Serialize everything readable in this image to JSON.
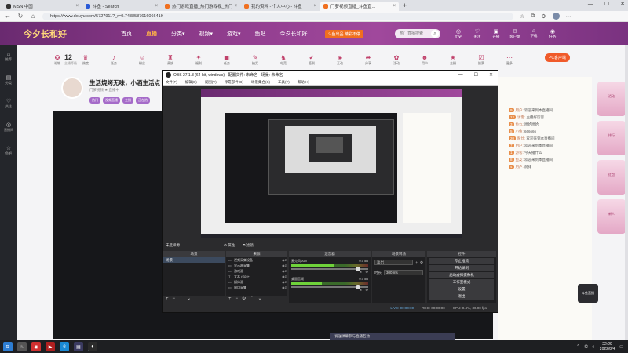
{
  "browser": {
    "tabs": [
      {
        "label": "MSN 中国",
        "color": "#333333",
        "active": false
      },
      {
        "label": "斗鱼 - Search",
        "color": "#2b5bd7",
        "active": false
      },
      {
        "label": "热门游戏直播_热门游戏视_热门...",
        "color": "#f07020",
        "active": false
      },
      {
        "label": "我的资料 - 个人中心 - 斗鱼",
        "color": "#f07020",
        "active": false
      },
      {
        "label": "门萝视频直播_斗鱼直...",
        "color": "#f07020",
        "active": true
      }
    ],
    "new_tab": "+",
    "window_controls": [
      "—",
      "☐",
      "✕"
    ],
    "url": "https://www.douyu.com/5727911?_r=0.7438587616066419"
  },
  "site": {
    "logo": "今夕长和好",
    "nav": [
      {
        "label": "首页",
        "active": false
      },
      {
        "label": "直播",
        "active": true
      },
      {
        "label": "分类▾",
        "active": false
      },
      {
        "label": "视频▾",
        "active": false
      },
      {
        "label": "游戏▾",
        "active": false
      },
      {
        "label": "鱼吧",
        "active": false
      },
      {
        "label": "今夕长和好",
        "active": false
      }
    ],
    "promo": "斗鱼出品 精彩不停",
    "search_placeholder": "热门直播搜索",
    "header_icons": [
      {
        "icon": "◎",
        "label": "历史"
      },
      {
        "icon": "♡",
        "label": "关注"
      },
      {
        "icon": "▣",
        "label": "开播"
      },
      {
        "icon": "✉",
        "label": "客户端"
      },
      {
        "icon": "⌂",
        "label": "下载"
      },
      {
        "icon": "◉",
        "label": "任务"
      }
    ]
  },
  "leftrail": [
    {
      "icon": "⌂",
      "label": "推荐"
    },
    {
      "icon": "▤",
      "label": "分类"
    },
    {
      "icon": "♡",
      "label": "关注"
    },
    {
      "icon": "◎",
      "label": "直播间"
    },
    {
      "icon": "☆",
      "label": "鱼吧"
    }
  ],
  "room": {
    "level": "12",
    "level_label": "主播等级",
    "gift_items": [
      "礼物",
      "热度",
      "任务",
      "粉丝",
      "贵族",
      "福利",
      "任务",
      "抽奖",
      "电竞",
      "签到",
      "互动",
      "分享",
      "活动",
      "用户",
      "主播",
      "投票",
      "更多"
    ],
    "pc_button": "PC客户端",
    "streamer_title": "生活烧烤无味，小酒生活点",
    "streamer_meta": "门萝视频 ★ 直播中",
    "tags": [
      "热门",
      "视频直播",
      "主播",
      "正在热"
    ]
  },
  "chat": {
    "lines": [
      {
        "lv": "9",
        "user": "用户",
        "text": "欢迎来到本直播间"
      },
      {
        "lv": "12",
        "user": "访客",
        "text": "主播好厉害"
      },
      {
        "lv": "3",
        "user": "鱼丸",
        "text": "哈哈哈哈"
      },
      {
        "lv": "5",
        "user": "小鱼",
        "text": "666666"
      },
      {
        "lv": "20",
        "user": "粉丝",
        "text": "欢迎来到本直播间"
      },
      {
        "lv": "7",
        "user": "用户",
        "text": "欢迎来到本直播间"
      },
      {
        "lv": "1",
        "user": "游客",
        "text": "今天播什么"
      },
      {
        "lv": "8",
        "user": "鱼友",
        "text": "欢迎来到本直播间"
      },
      {
        "lv": "4",
        "user": "用户",
        "text": "前排"
      }
    ],
    "bottom_prompt": "发送弹幕参与直播互动"
  },
  "ads": [
    "活动",
    "排行",
    "红包",
    "新人"
  ],
  "badge": "斗鱼直播",
  "obs": {
    "title": "OBS 27.1.3 (64-bit, windows) - 配置文件: 未命名 - 场景: 未命名",
    "menu": [
      "文件(F)",
      "编辑(E)",
      "视图(V)",
      "停靠部件(D)",
      "场景集合(S)",
      "工具(T)",
      "帮助(H)"
    ],
    "context_label": "未选择源",
    "props_btn": "⚙ 属性",
    "filter_btn": "⧉ 滤镜",
    "scenes_title": "场景",
    "scenes": [
      {
        "label": "场景",
        "selected": true
      }
    ],
    "sources_title": "来源",
    "sources": [
      {
        "icon": "▭",
        "label": "视频采集设备"
      },
      {
        "icon": "▭",
        "label": "显示器采集"
      },
      {
        "icon": "▭",
        "label": "游戏源"
      },
      {
        "icon": "T",
        "label": "文本 (GDI+)"
      },
      {
        "icon": "▭",
        "label": "媒体源"
      },
      {
        "icon": "▭",
        "label": "窗口采集"
      }
    ],
    "mixer_title": "混音器",
    "mixer": [
      {
        "name": "麦克风/Aux",
        "db": "0.0 dB",
        "level": 0.55,
        "volume": 0.85
      },
      {
        "name": "桌面音频",
        "db": "0.0 dB",
        "level": 0.4,
        "volume": 0.85
      }
    ],
    "transitions_title": "场景转场",
    "transition_type": "淡出",
    "transition_duration_label": "时长",
    "transition_duration": "300 ms",
    "controls_title": "控件",
    "controls": [
      "停止推流",
      "开始录制",
      "启动虚拟摄像机",
      "工作室模式",
      "设置",
      "退出"
    ],
    "status": [
      "LIVE: 00:00:00",
      "REC: 00:00:00",
      "CPU: 0.4%, 30.00 fps"
    ]
  },
  "taskbar": {
    "apps": [
      {
        "icon": "⊞",
        "color": "#2d7dd2"
      },
      {
        "icon": "♨",
        "color": "#555555"
      },
      {
        "icon": "◉",
        "color": "#d03030"
      },
      {
        "icon": "▶",
        "color": "#b02020"
      },
      {
        "icon": "e",
        "color": "#1a8ad4"
      },
      {
        "icon": "▤",
        "color": "#3a3a60"
      },
      {
        "icon": "◐",
        "color": "#2b2b2b"
      }
    ],
    "time": "22:29",
    "date": "2022/8/4"
  }
}
